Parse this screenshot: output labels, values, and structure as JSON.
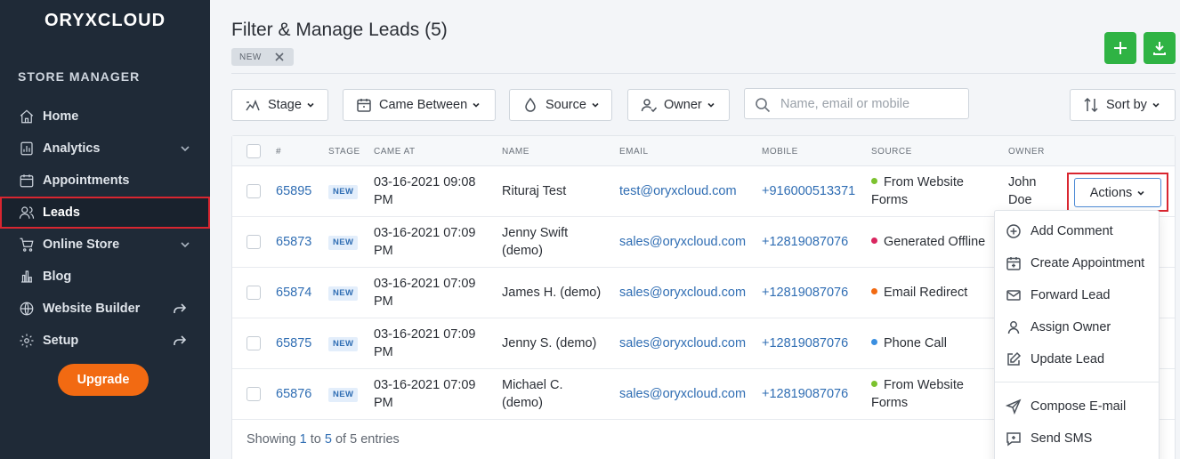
{
  "sidebar": {
    "brand": "ORYXCLOUD",
    "section_title": "STORE MANAGER",
    "items": [
      {
        "label": "Home"
      },
      {
        "label": "Analytics"
      },
      {
        "label": "Appointments"
      },
      {
        "label": "Leads"
      },
      {
        "label": "Online Store"
      },
      {
        "label": "Blog"
      },
      {
        "label": "Website Builder"
      },
      {
        "label": "Setup"
      }
    ],
    "upgrade_label": "Upgrade"
  },
  "header": {
    "title": "Filter & Manage Leads (5)",
    "filter_chip": "NEW"
  },
  "filters": {
    "stage": "Stage",
    "came_between": "Came Between",
    "source": "Source",
    "owner": "Owner",
    "search_placeholder": "Name, email or mobile",
    "sort_by": "Sort by"
  },
  "table": {
    "columns": [
      "#",
      "STAGE",
      "CAME AT",
      "NAME",
      "EMAIL",
      "MOBILE",
      "SOURCE",
      "OWNER"
    ],
    "rows": [
      {
        "id": "65895",
        "stage": "NEW",
        "came_at_1": "03-16-2021 09:08",
        "came_at_2": "PM",
        "name_1": "Rituraj Test",
        "name_2": "",
        "email": "test@oryxcloud.com",
        "mobile": "+916000513371",
        "source_1": "From Website",
        "source_2": "Forms",
        "source_color": "#7cc22f",
        "owner_1": "John",
        "owner_2": "Doe"
      },
      {
        "id": "65873",
        "stage": "NEW",
        "came_at_1": "03-16-2021 07:09",
        "came_at_2": "PM",
        "name_1": "Jenny Swift",
        "name_2": "(demo)",
        "email": "sales@oryxcloud.com",
        "mobile": "+12819087076",
        "source_1": "Generated Offline",
        "source_2": "",
        "source_color": "#d9265f",
        "owner_1": "",
        "owner_2": ""
      },
      {
        "id": "65874",
        "stage": "NEW",
        "came_at_1": "03-16-2021 07:09",
        "came_at_2": "PM",
        "name_1": "James H. (demo)",
        "name_2": "",
        "email": "sales@oryxcloud.com",
        "mobile": "+12819087076",
        "source_1": "Email Redirect",
        "source_2": "",
        "source_color": "#f26a12",
        "owner_1": "",
        "owner_2": ""
      },
      {
        "id": "65875",
        "stage": "NEW",
        "came_at_1": "03-16-2021 07:09",
        "came_at_2": "PM",
        "name_1": "Jenny S. (demo)",
        "name_2": "",
        "email": "sales@oryxcloud.com",
        "mobile": "+12819087076",
        "source_1": "Phone Call",
        "source_2": "",
        "source_color": "#3a8fe0",
        "owner_1": "",
        "owner_2": ""
      },
      {
        "id": "65876",
        "stage": "NEW",
        "came_at_1": "03-16-2021 07:09",
        "came_at_2": "PM",
        "name_1": "Michael C.",
        "name_2": "(demo)",
        "email": "sales@oryxcloud.com",
        "mobile": "+12819087076",
        "source_1": "From Website",
        "source_2": "Forms",
        "source_color": "#7cc22f",
        "owner_1": "",
        "owner_2": ""
      }
    ],
    "footer": {
      "prefix": "Showing ",
      "from": "1",
      "mid1": " to ",
      "to": "5",
      "mid2": " of ",
      "total": "5",
      "suffix": " entries"
    }
  },
  "actions": {
    "button_label": "Actions",
    "menu": [
      {
        "label": "Add Comment",
        "icon": "plus-circle-icon"
      },
      {
        "label": "Create Appointment",
        "icon": "calendar-plus-icon"
      },
      {
        "label": "Forward Lead",
        "icon": "mail-icon"
      },
      {
        "label": "Assign Owner",
        "icon": "user-icon"
      },
      {
        "label": "Update Lead",
        "icon": "edit-icon"
      },
      {
        "label": "Compose E-mail",
        "icon": "send-icon"
      },
      {
        "label": "Send SMS",
        "icon": "sms-icon"
      }
    ]
  },
  "colors": {
    "accent_green": "#2fb344",
    "upgrade_orange": "#f26a12",
    "highlight_red": "#d92630",
    "link_blue": "#2f6db3"
  }
}
